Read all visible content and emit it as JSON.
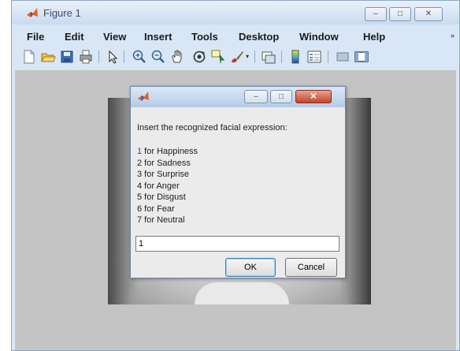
{
  "figure_window": {
    "title": "Figure 1",
    "controls": {
      "minimize": "‒",
      "maximize": "□",
      "close": "✕"
    }
  },
  "menubar": {
    "items": [
      "File",
      "Edit",
      "View",
      "Insert",
      "Tools",
      "Desktop",
      "Window",
      "Help"
    ],
    "overflow_glyph": "»"
  },
  "toolbar": {
    "icons": [
      "new-figure-icon",
      "open-file-icon",
      "save-icon",
      "print-icon",
      "pointer-icon",
      "zoom-in-icon",
      "zoom-out-icon",
      "pan-hand-icon",
      "rotate-3d-icon",
      "data-cursor-icon",
      "brush-icon",
      "link-plot-icon",
      "colorbar-icon",
      "legend-icon",
      "hide-plot-tools-icon",
      "show-plot-tools-icon"
    ]
  },
  "dialog": {
    "title": "",
    "prompt": "Insert the recognized facial expression:",
    "options": [
      {
        "num": "1",
        "text": " for Happiness"
      },
      {
        "num": "2",
        "text": " for Sadness"
      },
      {
        "num": "3",
        "text": " for Surprise"
      },
      {
        "num": "4",
        "text": " for Anger"
      },
      {
        "num": "5",
        "text": " for Disgust"
      },
      {
        "num": "6",
        "text": " for Fear"
      },
      {
        "num": "7",
        "text": " for Neutral"
      }
    ],
    "input_value": "1",
    "ok_label": "OK",
    "cancel_label": "Cancel",
    "controls": {
      "minimize": "‒",
      "maximize": "□",
      "close": "✕"
    }
  },
  "colors": {
    "matlab_orange": "#e8601c",
    "window_frame": "#d9e6f5",
    "figure_background": "#c4c4c4",
    "close_button_red": "#c5432a"
  }
}
